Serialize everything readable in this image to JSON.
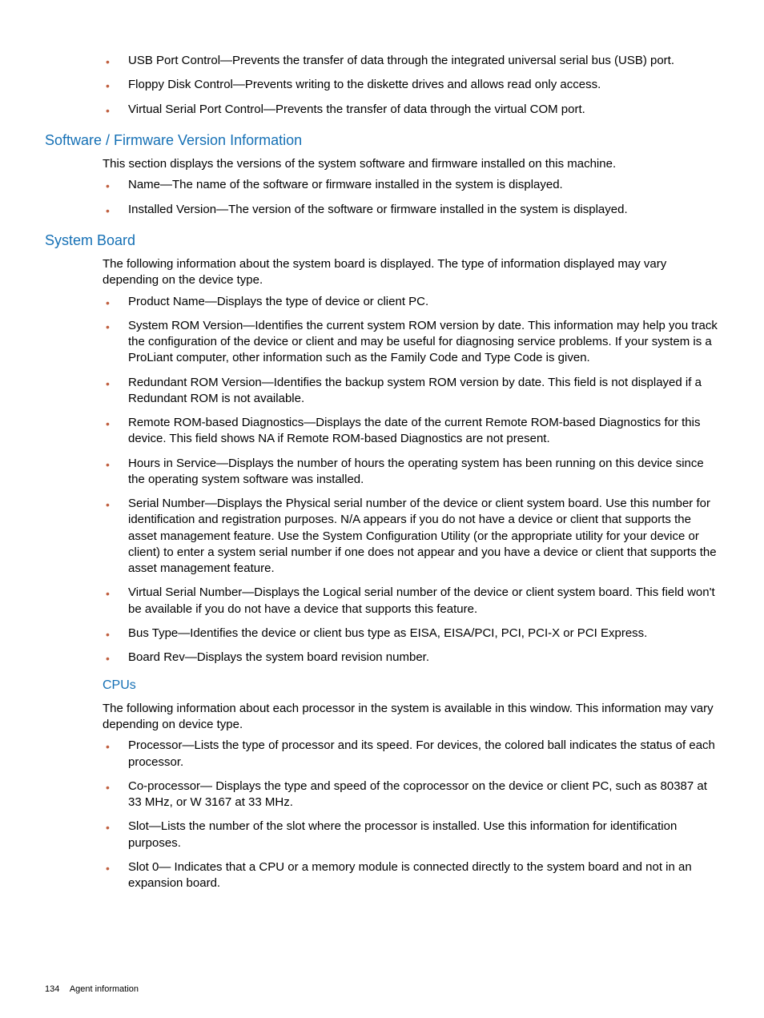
{
  "top_bullets": [
    "USB Port Control—Prevents the transfer of data through the integrated universal serial bus (USB) port.",
    "Floppy Disk Control—Prevents writing to the diskette drives and allows read only access.",
    "Virtual Serial Port Control—Prevents the transfer of data through the virtual COM port."
  ],
  "section_software": {
    "heading": "Software / Firmware Version Information",
    "intro": "This section displays the versions of the system software and firmware installed on this machine.",
    "bullets": [
      "Name—The name of the software or firmware installed in the system is displayed.",
      "Installed Version—The version of the software or firmware installed in the system is displayed."
    ]
  },
  "section_board": {
    "heading": "System Board",
    "intro": "The following information about the system board is displayed. The type of information displayed may vary depending on the device type.",
    "bullets": [
      "Product Name—Displays the type of device or client PC.",
      "System ROM Version—Identifies the current system ROM version by date. This information may help you track the configuration of the device or client and may be useful for diagnosing service problems. If your system is a ProLiant computer, other information such as the Family Code and Type Code is given.",
      "Redundant ROM Version—Identifies the backup system ROM version by date. This field is not displayed if a Redundant ROM is not available.",
      "Remote ROM-based Diagnostics—Displays the date of the current Remote ROM-based Diagnostics for this device. This field shows NA if Remote ROM-based Diagnostics are not present.",
      "Hours in Service—Displays the number of hours the operating system has been running on this device since the operating system software was installed.",
      "Serial Number—Displays the Physical serial number of the device or client system board. Use this number for identification and registration purposes. N/A appears if you do not have a device or client that supports the asset management feature. Use the System Configuration Utility (or the appropriate utility for your device or client) to enter a system serial number if one does not appear and you have a device or client that supports the asset management feature.",
      "Virtual Serial Number—Displays the Logical serial number of the device or client system board. This field won't be available if you do not have a device that supports this feature.",
      "Bus Type—Identifies the device or client bus type as EISA, EISA/PCI, PCI, PCI-X or PCI Express.",
      "Board Rev—Displays the system board revision number."
    ]
  },
  "section_cpus": {
    "heading": "CPUs",
    "intro": "The following information about each processor in the system is available in this window. This information may vary depending on device type.",
    "bullets": [
      "Processor—Lists the type of processor and its speed. For devices, the colored ball indicates the status of each processor.",
      "Co-processor— Displays the type and speed of the coprocessor on the device or client PC, such as 80387 at 33 MHz, or W 3167 at 33 MHz.",
      "Slot—Lists the number of the slot where the processor is installed. Use this information for identification purposes.",
      "Slot 0— Indicates that a CPU or a memory module is connected directly to the system board and not in an expansion board."
    ]
  },
  "footer": {
    "page_number": "134",
    "label": "Agent information"
  }
}
